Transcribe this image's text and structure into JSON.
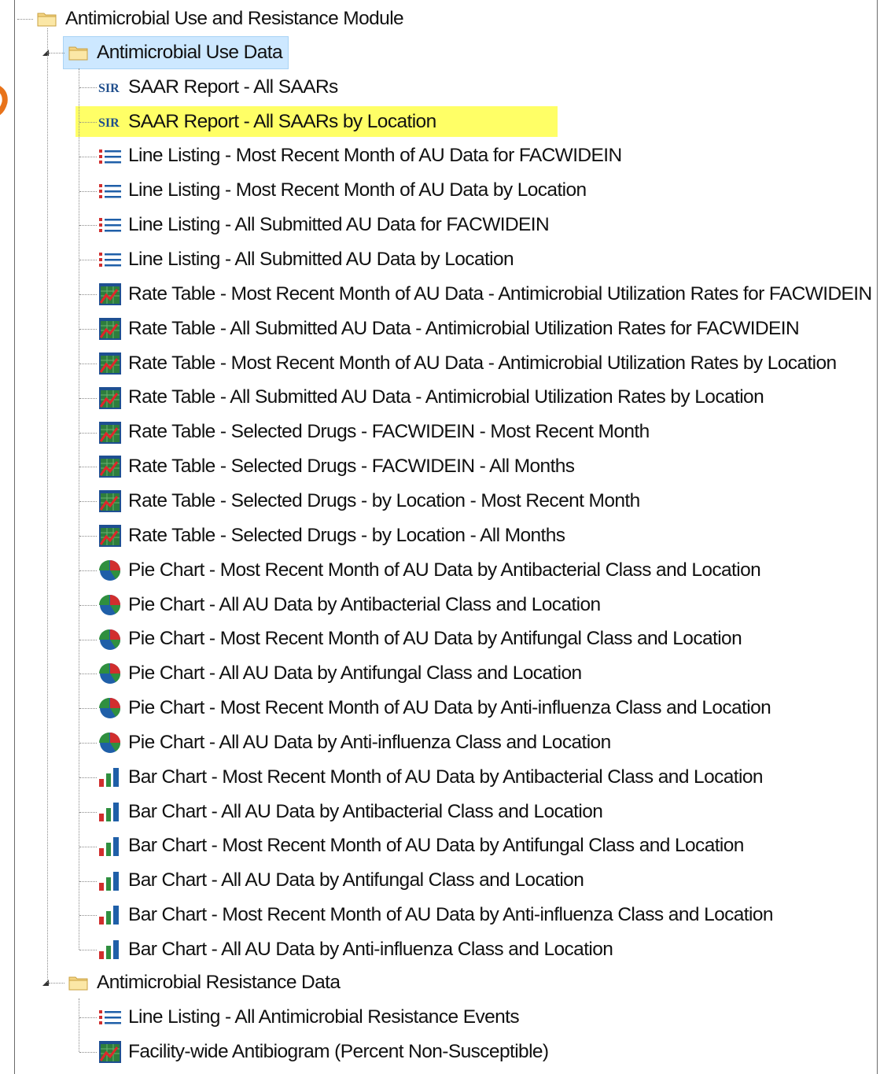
{
  "tree": {
    "root": {
      "label": "Antimicrobial Use and Resistance Module",
      "icon": "folder-icon"
    },
    "use_folder": {
      "label": "Antimicrobial Use Data",
      "icon": "folder-icon",
      "items": [
        {
          "label": "SAAR Report - All SAARs",
          "icon": "sir-icon"
        },
        {
          "label": "SAAR Report - All SAARs by Location",
          "icon": "sir-icon"
        },
        {
          "label": "Line Listing - Most Recent Month of AU Data for FACWIDEIN",
          "icon": "list-icon"
        },
        {
          "label": "Line Listing - Most Recent Month of AU Data by Location",
          "icon": "list-icon"
        },
        {
          "label": "Line Listing - All Submitted AU Data for FACWIDEIN",
          "icon": "list-icon"
        },
        {
          "label": "Line Listing - All Submitted AU Data by Location",
          "icon": "list-icon"
        },
        {
          "label": "Rate Table - Most Recent Month of AU Data - Antimicrobial Utilization Rates for FACWIDEIN",
          "icon": "rate-table-icon"
        },
        {
          "label": "Rate Table - All Submitted AU Data - Antimicrobial Utilization Rates for FACWIDEIN",
          "icon": "rate-table-icon"
        },
        {
          "label": "Rate Table - Most Recent Month of AU Data - Antimicrobial Utilization Rates by Location",
          "icon": "rate-table-icon"
        },
        {
          "label": "Rate Table - All Submitted AU Data - Antimicrobial Utilization Rates by Location",
          "icon": "rate-table-icon"
        },
        {
          "label": "Rate Table - Selected Drugs - FACWIDEIN - Most Recent Month",
          "icon": "rate-table-icon"
        },
        {
          "label": "Rate Table - Selected Drugs - FACWIDEIN - All Months",
          "icon": "rate-table-icon"
        },
        {
          "label": "Rate Table - Selected Drugs - by Location - Most Recent Month",
          "icon": "rate-table-icon"
        },
        {
          "label": "Rate Table - Selected Drugs - by Location - All Months",
          "icon": "rate-table-icon"
        },
        {
          "label": "Pie Chart - Most Recent Month of AU Data by Antibacterial Class and Location",
          "icon": "pie-chart-icon"
        },
        {
          "label": "Pie Chart - All AU Data by Antibacterial Class and Location",
          "icon": "pie-chart-icon"
        },
        {
          "label": "Pie Chart - Most Recent Month of AU Data by Antifungal Class and Location",
          "icon": "pie-chart-icon"
        },
        {
          "label": "Pie Chart - All AU Data by Antifungal Class and Location",
          "icon": "pie-chart-icon"
        },
        {
          "label": "Pie Chart - Most Recent Month of AU Data by Anti-influenza Class and Location",
          "icon": "pie-chart-icon"
        },
        {
          "label": "Pie Chart - All AU Data by Anti-influenza Class and Location",
          "icon": "pie-chart-icon"
        },
        {
          "label": "Bar Chart - Most Recent Month of AU Data by Antibacterial Class and Location",
          "icon": "bar-chart-icon"
        },
        {
          "label": "Bar Chart - All AU Data by Antibacterial Class and Location",
          "icon": "bar-chart-icon"
        },
        {
          "label": "Bar Chart - Most Recent Month of AU Data by Antifungal Class and Location",
          "icon": "bar-chart-icon"
        },
        {
          "label": "Bar Chart - All AU Data by Antifungal Class and Location",
          "icon": "bar-chart-icon"
        },
        {
          "label": "Bar Chart - Most Recent Month of AU Data by Anti-influenza Class and Location",
          "icon": "bar-chart-icon"
        },
        {
          "label": "Bar Chart - All AU Data by Anti-influenza Class and Location",
          "icon": "bar-chart-icon"
        }
      ]
    },
    "resistance_folder": {
      "label": "Antimicrobial Resistance Data",
      "icon": "folder-icon",
      "items": [
        {
          "label": "Line Listing - All Antimicrobial Resistance Events",
          "icon": "list-icon"
        },
        {
          "label": "Facility-wide Antibiogram (Percent Non-Susceptible)",
          "icon": "rate-table-icon"
        }
      ]
    },
    "highlighted_item": "SAAR Report - All SAARs by Location",
    "selected_folder": "Antimicrobial Use Data"
  },
  "colors": {
    "highlight": "#ffff66",
    "selection": "#cde8ff",
    "sir_text": "#1f4e8c",
    "accent_orange": "#e8731a"
  }
}
